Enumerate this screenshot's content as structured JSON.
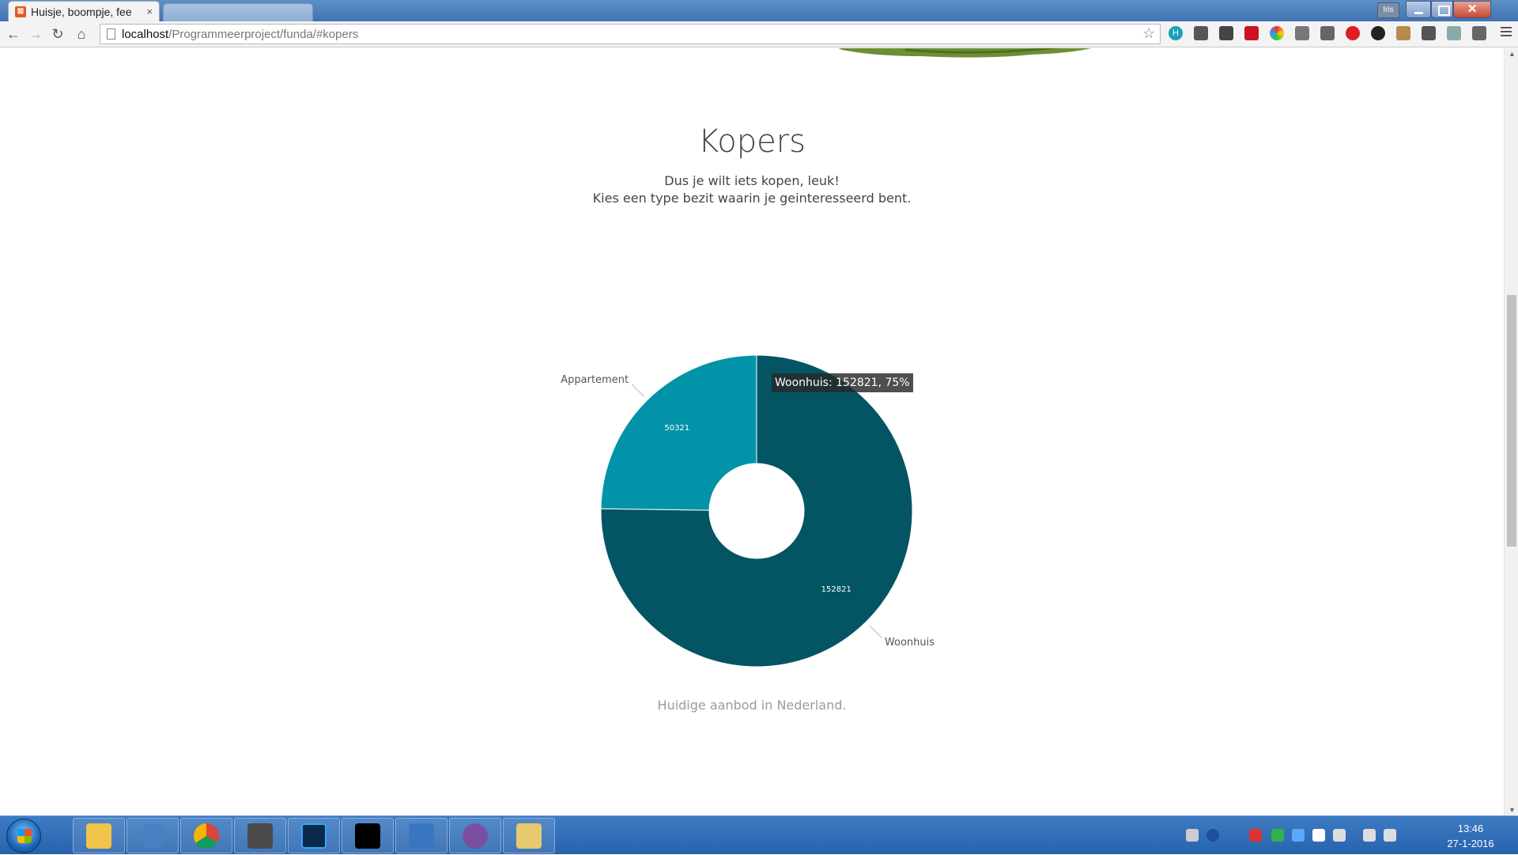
{
  "browser": {
    "tab_title": "Huisje, boompje, fee",
    "tab_close": "×",
    "url_host": "localhost",
    "url_path": "/Programmeerproject/funda/#kopers",
    "user_badge": "Iris"
  },
  "page": {
    "title": "Kopers",
    "subtitle_line1": "Dus je wilt iets kopen, leuk!",
    "subtitle_line2": "Kies een type bezit waarin je geinteresseerd bent.",
    "caption": "Huidige aanbod in Nederland.",
    "tooltip": "Woonhuis: 152821, 75%"
  },
  "chart_data": {
    "type": "pie",
    "donut": true,
    "categories": [
      "Woonhuis",
      "Appartement"
    ],
    "values": [
      152821,
      50321
    ],
    "colors": [
      "#035563",
      "#0293a8"
    ],
    "data_labels": [
      "152821",
      "50321"
    ],
    "title": "",
    "legend": "none"
  },
  "taskbar": {
    "clock_time": "13:46",
    "clock_date": "27-1-2016"
  },
  "colors": {
    "accent_dark": "#035563",
    "accent_light": "#0293a8",
    "taskbar": "#2763ad"
  }
}
